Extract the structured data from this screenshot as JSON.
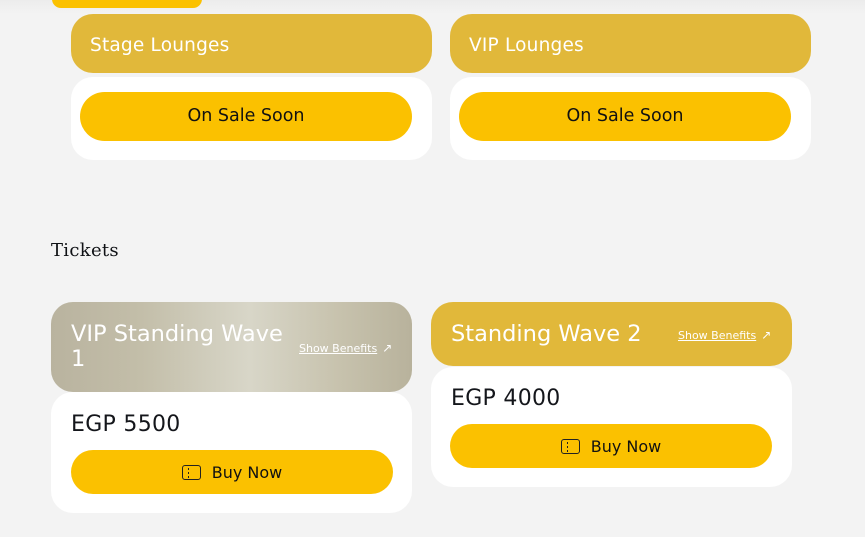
{
  "lounges": [
    {
      "name": "Stage Lounges",
      "button_label": "On Sale Soon"
    },
    {
      "name": "VIP Lounges",
      "button_label": "On Sale Soon"
    }
  ],
  "tickets_section": {
    "title": "Tickets"
  },
  "tickets": [
    {
      "name": "VIP Standing Wave 1",
      "benefits_label": "Show Benefits",
      "price": "EGP 5500",
      "buy_label": "Buy Now"
    },
    {
      "name": "Standing Wave 2",
      "benefits_label": "Show Benefits",
      "price": "EGP 4000",
      "buy_label": "Buy Now"
    }
  ],
  "colors": {
    "accent": "#fbc100",
    "header_gold": "#e1b83a",
    "background": "#f3f3f3",
    "card": "#ffffff"
  },
  "icons": {
    "arrow": "arrow-up-right-icon",
    "ticket": "ticket-icon"
  }
}
